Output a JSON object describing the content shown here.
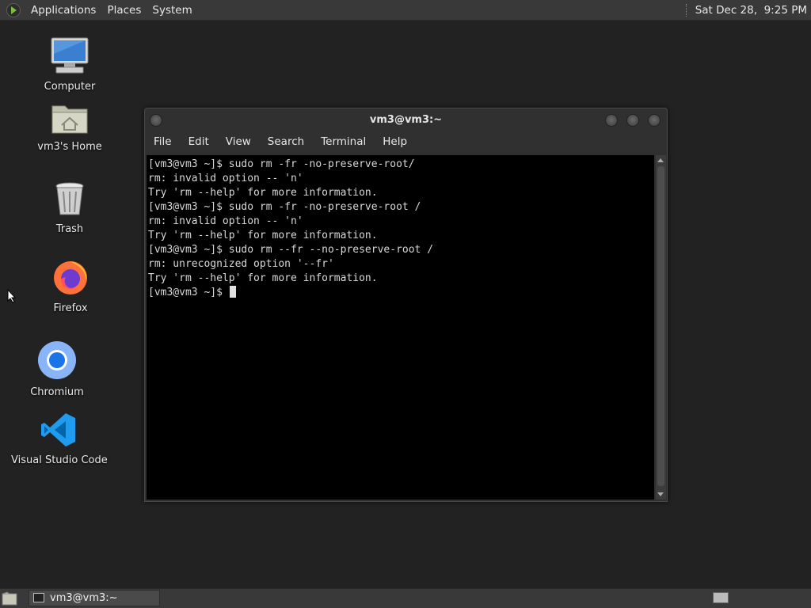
{
  "top_panel": {
    "menus": [
      "Applications",
      "Places",
      "System"
    ],
    "clock": "Sat Dec 28,  9:25 PM"
  },
  "desktop": {
    "icons": [
      {
        "label": "Computer",
        "icon": "computer-icon"
      },
      {
        "label": "vm3's Home",
        "icon": "home-folder-icon"
      },
      {
        "label": "Trash",
        "icon": "trash-icon"
      },
      {
        "label": "Firefox",
        "icon": "firefox-icon"
      },
      {
        "label": "Chromium",
        "icon": "chromium-icon"
      },
      {
        "label": "Visual Studio Code",
        "icon": "vscode-icon"
      }
    ]
  },
  "terminal": {
    "title": "vm3@vm3:~",
    "menu": [
      "File",
      "Edit",
      "View",
      "Search",
      "Terminal",
      "Help"
    ],
    "lines": [
      "[vm3@vm3 ~]$ sudo rm -fr -no-preserve-root/",
      "rm: invalid option -- 'n'",
      "Try 'rm --help' for more information.",
      "[vm3@vm3 ~]$ sudo rm -fr -no-preserve-root /",
      "rm: invalid option -- 'n'",
      "Try 'rm --help' for more information.",
      "[vm3@vm3 ~]$ sudo rm --fr --no-preserve-root /",
      "rm: unrecognized option '--fr'",
      "Try 'rm --help' for more information."
    ],
    "prompt": "[vm3@vm3 ~]$ "
  },
  "taskbar": {
    "window_button": "vm3@vm3:~"
  },
  "colors": {
    "desktop_bg": "#222222",
    "panel_bg": "#393939",
    "terminal_bg": "#000000",
    "terminal_fg": "#d8d8d8"
  }
}
